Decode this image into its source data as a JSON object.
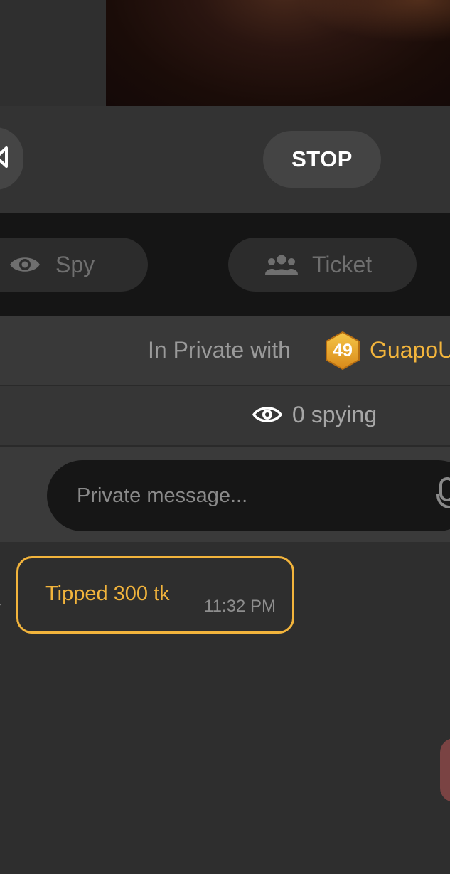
{
  "controls": {
    "stop_label": "STOP"
  },
  "modes": {
    "spy_label": "Spy",
    "ticket_label": "Ticket"
  },
  "private_session": {
    "prefix": "In Private with",
    "level": "49",
    "username": "GuapoU"
  },
  "spying": {
    "text": "0 spying"
  },
  "message_input": {
    "placeholder": "Private message..."
  },
  "chat": {
    "messages": [
      {
        "text": "Tipped 300 tk",
        "time": "11:32 PM"
      }
    ]
  },
  "colors": {
    "accent": "#f2b43c",
    "background": "#2e2e2e",
    "strip": "#151515"
  }
}
